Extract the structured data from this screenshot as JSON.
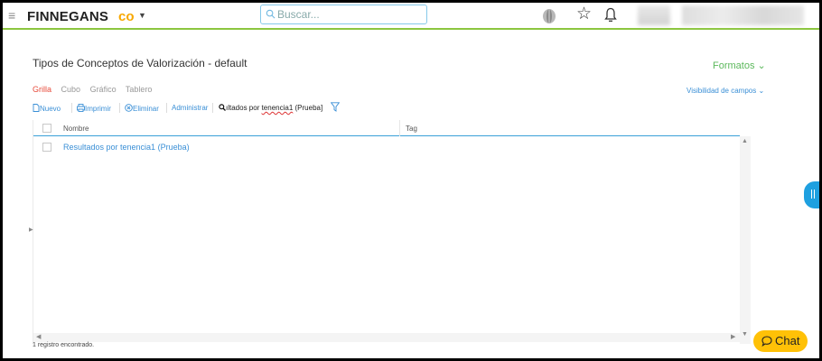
{
  "header": {
    "menu_icon": "hamburger-icon",
    "brand": "FINNEGANS",
    "brand_mark": "co",
    "search_placeholder": "Buscar...",
    "accent": "#8cc63f"
  },
  "page": {
    "title": "Tipos de Conceptos de Valorización - default",
    "formatos": "Formatos ⌄",
    "visibilidad": "Visibilidad de campos ⌄",
    "view_tabs": [
      {
        "label": "Grilla",
        "active": true
      },
      {
        "label": "Cubo",
        "active": false
      },
      {
        "label": "Gráfico",
        "active": false
      },
      {
        "label": "Tablero",
        "active": false
      }
    ]
  },
  "toolbar": {
    "nuevo": "Nuevo",
    "imprimir": "Imprimir",
    "eliminar": "Eliminar",
    "administrar": "Administrar",
    "search_prefix": "ıltados por ",
    "search_squiggle": "tenencia1",
    "search_suffix": " (Prueba]"
  },
  "grid": {
    "columns": [
      "Nombre",
      "Tag"
    ],
    "rows": [
      {
        "nombre": "Resultados por tenencia1 (Prueba)",
        "tag": ""
      }
    ],
    "footer": "1 registro encontrado."
  },
  "chat": {
    "label": "Chat",
    "color": "#ffc107"
  }
}
